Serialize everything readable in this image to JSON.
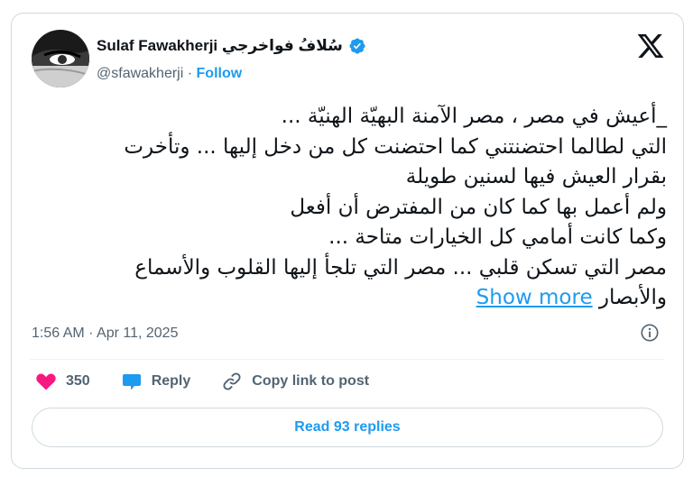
{
  "author": {
    "display_name": "Sulaf Fawakherji سُلافُ فواخرجي",
    "handle": "@sfawakherji",
    "separator": "·",
    "follow_label": "Follow",
    "verified": true
  },
  "tweet": {
    "lines": [
      "_أعيش في مصر ، مصر الآمنة البهيّة الهنيّة ...",
      "التي لطالما احتضنتني كما احتضنت كل من دخل إليها ... وتأخرت",
      "بقرار العيش فيها لسنين طويلة",
      "ولم أعمل بها كما كان من المفترض أن أفعل",
      "وكما كانت أمامي كل الخيارات متاحة ...",
      "مصر التي تسكن قلبي ... مصر التي تلجأ إليها القلوب والأسماع",
      "والأبصار"
    ],
    "show_more_label": "Show more",
    "timestamp": "1:56 AM · Apr 11, 2025"
  },
  "actions": {
    "likes_count": "350",
    "reply_label": "Reply",
    "copy_link_label": "Copy link to post"
  },
  "read_replies_label": "Read 93 replies",
  "colors": {
    "accent": "#1d9bf0",
    "like": "#f91880",
    "muted": "#536471",
    "border": "#cfd9de"
  }
}
